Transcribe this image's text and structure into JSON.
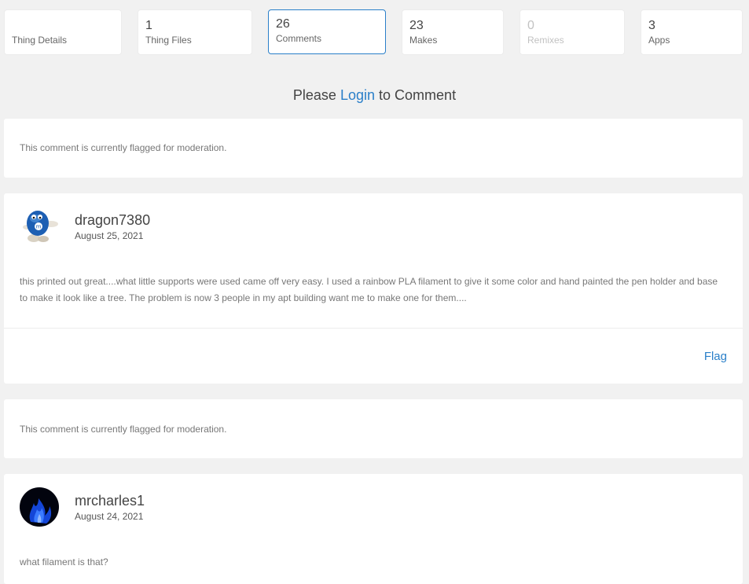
{
  "tabs": [
    {
      "count": "",
      "label": "Thing Details"
    },
    {
      "count": "1",
      "label": "Thing Files"
    },
    {
      "count": "26",
      "label": "Comments"
    },
    {
      "count": "23",
      "label": "Makes"
    },
    {
      "count": "0",
      "label": "Remixes"
    },
    {
      "count": "3",
      "label": "Apps"
    }
  ],
  "login": {
    "prefix": "Please",
    "link": "Login",
    "suffix": "to Comment"
  },
  "flagged_message": "This comment is currently flagged for moderation.",
  "comments": [
    {
      "username": "dragon7380",
      "date": "August 25, 2021",
      "text": "this printed out great....what little supports were used came off very easy. I used a rainbow PLA filament to give it some color and hand painted the pen holder and base to make it look like a tree. The problem is now 3 people in my apt building want me to make one for them....",
      "flag_label": "Flag"
    },
    {
      "username": "mrcharles1",
      "date": "August 24, 2021",
      "text": "what filament is that?"
    }
  ],
  "colors": {
    "accent": "#2a7fc9",
    "background": "#f1f1f1"
  }
}
